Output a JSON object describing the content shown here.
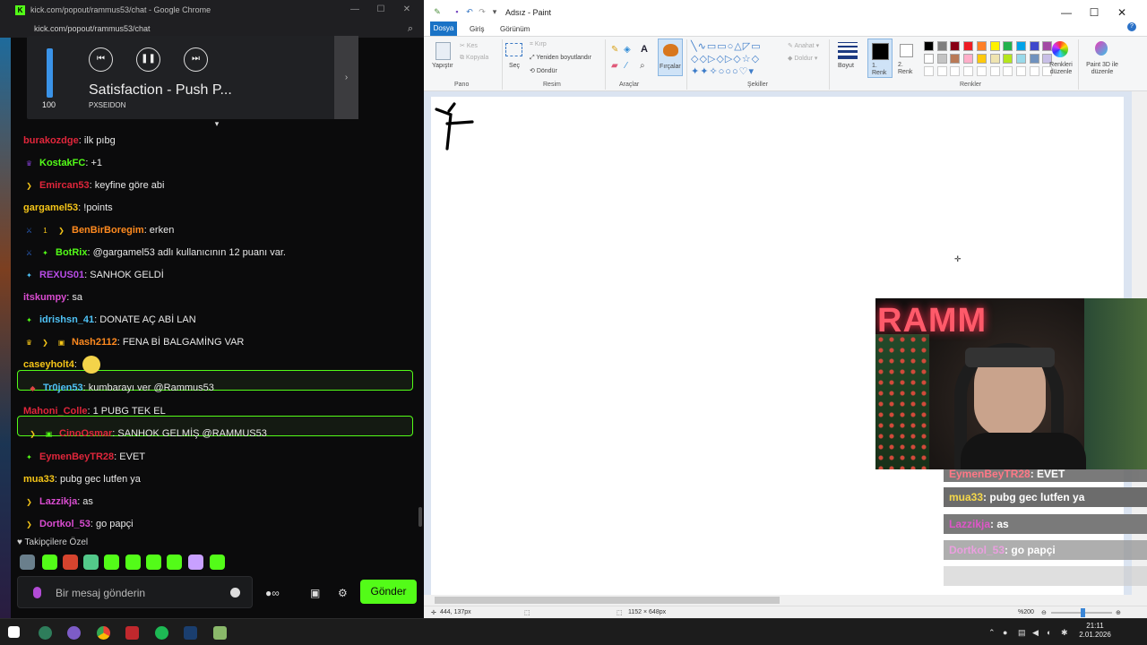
{
  "chrome": {
    "title": "kick.com/popout/rammus53/chat - Google Chrome",
    "url": "kick.com/popout/rammus53/chat"
  },
  "media": {
    "volume": "100",
    "volume_level": 1.0,
    "song": "Satisfaction - Push P...",
    "artist": "PXSEIDON"
  },
  "chat": {
    "messages": [
      {
        "user": "burakozdge",
        "text": ": ilk pıbg",
        "color": "#e0263b"
      },
      {
        "user": "KostakFC",
        "text": ": +1",
        "color": "#53fc18"
      },
      {
        "user": "Emircan53",
        "text": ": keyfine göre abi",
        "color": "#e0263b"
      },
      {
        "user": "gargamel53",
        "text": ": !points",
        "color": "#f5c518"
      },
      {
        "user": "BenBirBoregim",
        "text": ": erken",
        "color": "#ff8a1f"
      },
      {
        "user": "BotRix",
        "text": ": @gargamel53 adlı kullanıcının 12 puanı var.",
        "color": "#53fc18"
      },
      {
        "user": "REXUS01",
        "text": ": SANHOK GELDİ",
        "color": "#b84ce6"
      },
      {
        "user": "itskumpy",
        "text": ": sa",
        "color": "#d94cd0"
      },
      {
        "user": "idrishsn_41",
        "text": ": DONATE AÇ ABİ LAN",
        "color": "#4fc3f7"
      },
      {
        "user": "Nash2112",
        "text": ": FENA Bİ BALGAMİNG VAR",
        "color": "#ff8a1f"
      },
      {
        "user": "caseyholt4",
        "text": ":",
        "color": "#f5c518"
      },
      {
        "user": "Tr0jen53",
        "text": ": kumbarayı ver @Rammus53",
        "color": "#4fc3f7"
      },
      {
        "user": "Mahoni_Colle",
        "text": ": 1 PUBG TEK EL",
        "color": "#e0263b"
      },
      {
        "user": "CinoOsmar",
        "text": ": SANHOK GELMİŞ @RAMMUS53",
        "color": "#e0263b"
      },
      {
        "user": "EymenBeyTR28",
        "text": ": EVET",
        "color": "#e0263b"
      },
      {
        "user": "mua33",
        "text": ": pubg gec lutfen ya",
        "color": "#f5c518"
      },
      {
        "user": "Lazzikja",
        "text": ": as",
        "color": "#d94cd0"
      },
      {
        "user": "Dortkol_53",
        "text": ": go papçi",
        "color": "#d94cd0"
      }
    ],
    "followers_label": "♥ Takipçilere Özel",
    "input_placeholder": "Bir mesaj gönderin",
    "send_label": "Gönder"
  },
  "paint": {
    "title": "Adsız - Paint",
    "tabs": {
      "file": "Dosya",
      "home": "Giriş",
      "view": "Görünüm"
    },
    "clipboard": {
      "paste": "Yapıştır",
      "cut": "Kes",
      "copy": "Kopyala",
      "group": "Pano"
    },
    "image": {
      "select": "Seç",
      "crop": "Kırp",
      "resize": "Yeniden boyutlandır",
      "rotate": "Döndür",
      "group": "Resim"
    },
    "tools_group": "Araçlar",
    "brushes": "Fırçalar",
    "shapes": {
      "outline": "Anahat",
      "fill": "Doldur",
      "group": "Şekiller"
    },
    "size": "Boyut",
    "color1": "1.\nRenk",
    "color2": "2.\nRenk",
    "colors_group": "Renkler",
    "edit_colors": "Renkleri düzenle",
    "paint3d": "Paint 3D ile düzenle",
    "status": {
      "cursor": "444, 137px",
      "canvas_size": "1152 × 648px",
      "zoom": "%200"
    },
    "palette_row1": [
      "#000000",
      "#7f7f7f",
      "#880015",
      "#ed1c24",
      "#ff7f27",
      "#fff200",
      "#22b14c",
      "#00a2e8",
      "#3f48cc",
      "#a349a4"
    ],
    "palette_row2": [
      "#ffffff",
      "#c3c3c3",
      "#b97a57",
      "#ffaec9",
      "#ffc90e",
      "#efe4b0",
      "#b5e61d",
      "#99d9ea",
      "#7092be",
      "#c8bfe7"
    ]
  },
  "overlay": {
    "lines": [
      {
        "user": "EymenBeyTR28",
        "text": ": EVET"
      },
      {
        "user": "mua33",
        "text": ": pubg gec lutfen ya"
      },
      {
        "user": "Lazzikja",
        "text": ": as"
      },
      {
        "user": "Dortkol_53",
        "text": ": go papçi"
      }
    ],
    "webcam_text": "RAMM"
  },
  "taskbar": {
    "time": "21:11",
    "date": "2.01.2026"
  }
}
